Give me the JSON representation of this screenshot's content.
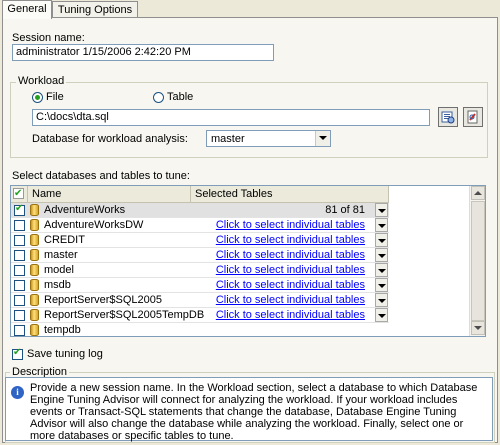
{
  "tabs": [
    {
      "label": "General",
      "active": true
    },
    {
      "label": "Tuning Options",
      "active": false
    }
  ],
  "session": {
    "label": "Session name:",
    "value": "administrator 1/15/2006 2:42:20 PM"
  },
  "workload": {
    "group_label": "Workload",
    "file_label": "File",
    "table_label": "Table",
    "selected": "File",
    "path": "C:\\docs\\dta.sql",
    "db_label": "Database for workload analysis:",
    "db_value": "master",
    "browse_icon": "browse-file-icon",
    "preview_icon": "preview-xml-icon"
  },
  "databases": {
    "label": "Select databases and tables to tune:",
    "col_name": "Name",
    "col_tables": "Selected Tables",
    "rows": [
      {
        "name": "AdventureWorks",
        "tables": "81 of 81",
        "checked": true,
        "selected": true,
        "link": false
      },
      {
        "name": "AdventureWorksDW",
        "tables": "Click to select individual tables",
        "checked": false,
        "selected": false,
        "link": true
      },
      {
        "name": "CREDIT",
        "tables": "Click to select individual tables",
        "checked": false,
        "selected": false,
        "link": true
      },
      {
        "name": "master",
        "tables": "Click to select individual tables",
        "checked": false,
        "selected": false,
        "link": true
      },
      {
        "name": "model",
        "tables": "Click to select individual tables",
        "checked": false,
        "selected": false,
        "link": true
      },
      {
        "name": "msdb",
        "tables": "Click to select individual tables",
        "checked": false,
        "selected": false,
        "link": true
      },
      {
        "name": "ReportServer$SQL2005",
        "tables": "Click to select individual tables",
        "checked": false,
        "selected": false,
        "link": true
      },
      {
        "name": "ReportServer$SQL2005TempDB",
        "tables": "Click to select individual tables",
        "checked": false,
        "selected": false,
        "link": true
      },
      {
        "name": "tempdb",
        "tables": "",
        "checked": false,
        "selected": false,
        "link": false
      }
    ]
  },
  "save_log": {
    "label": "Save tuning log",
    "checked": true
  },
  "description": {
    "label": "Description",
    "icon": "info-icon",
    "text": "Provide a new session name. In the Workload section, select a database to which Database Engine Tuning Advisor will connect for analyzing the workload. If your workload includes events or Transact-SQL statements that change the database, Database Engine Tuning Advisor will also change the database while analyzing the workload. Finally, select one or more databases or specific tables to tune."
  },
  "colors": {
    "accent": "#7f9db9",
    "link": "#0000ff",
    "check": "#21a121"
  }
}
